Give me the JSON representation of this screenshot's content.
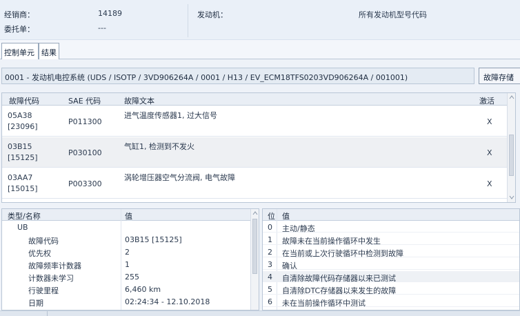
{
  "header": {
    "dealer_label": "经销商：",
    "dealer_value": "14189",
    "order_label": "委托单：",
    "order_value": "---",
    "engine_label": "发动机：",
    "engine_value": "所有发动机型号代码"
  },
  "tabs": [
    {
      "label": "控制单元"
    },
    {
      "label": "结果"
    }
  ],
  "module": {
    "text": "0001 - 发动机电控系统 (UDS / ISOTP / 3VD906264A / 0001 / H13 / EV_ECM18TFS0203VD906264A / 001001)",
    "button_label": "故障存储"
  },
  "dtc_table": {
    "columns": [
      "故障代码",
      "SAE 代码",
      "故障文本",
      "激活"
    ],
    "rows": [
      {
        "code": "05A38",
        "code_dec": "[23096]",
        "sae": "P011300",
        "text": "进气温度传感器1, 过大信号",
        "active": "X"
      },
      {
        "code": "03B15",
        "code_dec": "[15125]",
        "sae": "P030100",
        "text": "气缸1, 检测到不发火",
        "active": "X"
      },
      {
        "code": "03AA7",
        "code_dec": "[15015]",
        "sae": "P003300",
        "text": "涡轮增压器空气分流阀, 电气故障",
        "active": "X"
      }
    ]
  },
  "props_table": {
    "columns": [
      "类型/名称",
      "值"
    ],
    "rows": [
      {
        "name": "UB",
        "value": ""
      },
      {
        "name": "故障代码",
        "value": "03B15 [15125]"
      },
      {
        "name": "优先权",
        "value": "2"
      },
      {
        "name": "故障频率计数器",
        "value": "1"
      },
      {
        "name": "计数器未学习",
        "value": "255"
      },
      {
        "name": "行驶里程",
        "value": "6,460 km"
      },
      {
        "name": "日期",
        "value": "02:24:34 - 12.10.2018"
      }
    ]
  },
  "bits_table": {
    "columns": [
      "位",
      "值"
    ],
    "rows": [
      {
        "pos": "0",
        "value": "主动/静态"
      },
      {
        "pos": "1",
        "value": "故障未在当前操作循环中发生"
      },
      {
        "pos": "2",
        "value": "在当前或上次行驶循环中检测到故障"
      },
      {
        "pos": "3",
        "value": "确认"
      },
      {
        "pos": "4",
        "value": "自清除故障代码存储器以来已测试"
      },
      {
        "pos": "5",
        "value": "自清除DTC存储器以来发生的故障"
      },
      {
        "pos": "6",
        "value": "未在当前操作循环中测试"
      }
    ]
  }
}
